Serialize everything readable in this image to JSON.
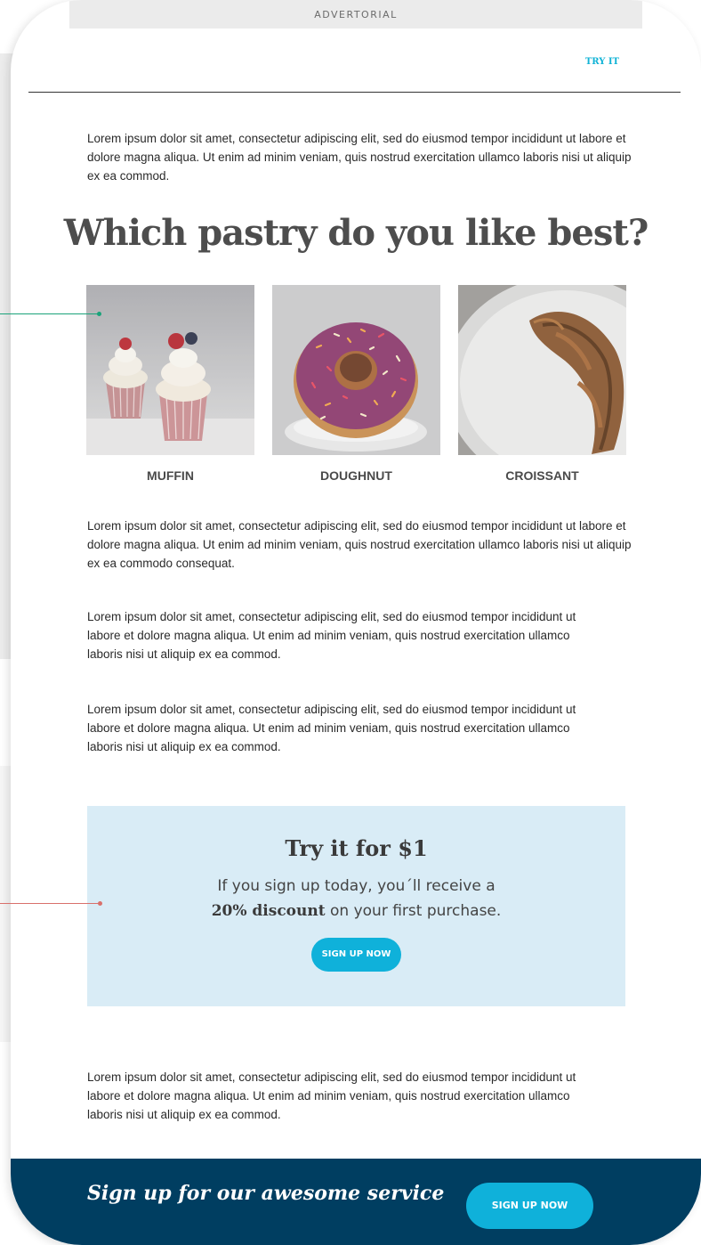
{
  "header": {
    "advertorial_label": "ADVERTORIAL",
    "try_it_link": "TRY IT"
  },
  "intro": "Lorem ipsum dolor sit amet, consectetur adipiscing elit, sed do eiusmod tempor incididunt ut labore et dolore magna aliqua. Ut enim ad minim veniam, quis nostrud exercitation ullamco laboris nisi ut aliquip ex ea commod.",
  "headline": "Which pastry do you like best?",
  "pastries": [
    {
      "label": "MUFFIN"
    },
    {
      "label": "DOUGHNUT"
    },
    {
      "label": "CROISSANT"
    }
  ],
  "paragraphs": [
    "Lorem ipsum dolor sit amet, consectetur adipiscing elit, sed do eiusmod tempor incididunt ut labore et dolore magna aliqua. Ut enim ad minim veniam, quis nostrud exercitation ullamco laboris nisi ut aliquip ex ea commodo consequat.",
    "Lorem ipsum dolor sit amet, consectetur adipiscing elit, sed do eiusmod tempor incididunt ut labore et dolore magna aliqua. Ut enim ad minim veniam, quis nostrud exercitation ullamco laboris nisi ut aliquip ex ea commod.",
    "Lorem ipsum dolor sit amet, consectetur adipiscing elit, sed do eiusmod tempor incididunt ut labore et dolore magna aliqua. Ut enim ad minim veniam, quis nostrud exercitation ullamco laboris nisi ut aliquip ex ea commod."
  ],
  "promo": {
    "title": "Try it for $1",
    "text_line1": "If you sign up today, you´ll receive a",
    "discount": "20% discount",
    "text_line2_rest": " on your first purchase.",
    "button": "SIGN UP NOW"
  },
  "closing_paragraph": "Lorem ipsum dolor sit amet, consectetur adipiscing elit, sed do eiusmod tempor incididunt ut labore et dolore magna aliqua. Ut enim ad minim veniam, quis nostrud exercitation ullamco laboris nisi ut aliquip ex ea commod.",
  "footer": {
    "tagline": "Sign up for our awesome service",
    "button": "SIGN UP NOW"
  },
  "colors": {
    "accent": "#0fb1da",
    "footer_bg": "#003e61",
    "promo_bg": "#d9ecf6",
    "annotation_green": "#1aa37a",
    "annotation_red": "#d9706b"
  }
}
